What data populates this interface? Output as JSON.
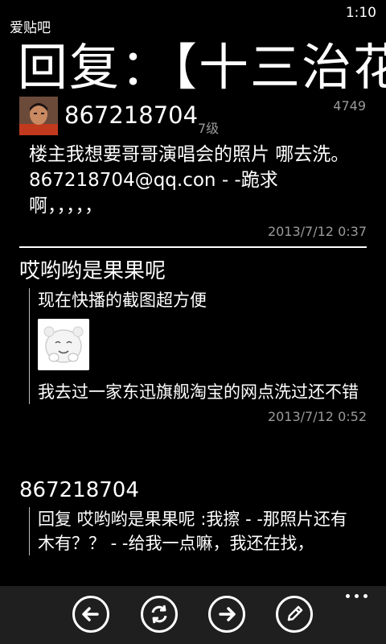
{
  "status": {
    "time": "1:10"
  },
  "app": {
    "title": "爱贴吧"
  },
  "thread": {
    "title": "回复：【十三治花"
  },
  "op": {
    "name": "867218704",
    "level": "7级",
    "post_number": "4749",
    "content": "楼主我想要哥哥演唱会的照片 哪去洗。 867218704@qq.con - -跪求啊，，，，，",
    "time": "2013/7/12 0:37"
  },
  "replies": [
    {
      "author": "哎哟哟是果果呢",
      "lines": [
        "现在快播的截图超方便",
        "我去过一家东迅旗舰淘宝的网点洗过还不错"
      ],
      "has_sticker": true,
      "time": "2013/7/12 0:52"
    },
    {
      "author": "867218704",
      "lines": [
        "回复 哎哟哟是果果呢 :我擦 - -那照片还有木有？？ - -给我一点嘛，我还在找，"
      ],
      "has_sticker": false,
      "time": ""
    }
  ],
  "appbar": {
    "buttons": [
      {
        "icon": "back-arrow-icon"
      },
      {
        "icon": "refresh-icon"
      },
      {
        "icon": "forward-arrow-icon"
      },
      {
        "icon": "edit-pencil-icon"
      }
    ],
    "more": "more-dots-icon"
  }
}
